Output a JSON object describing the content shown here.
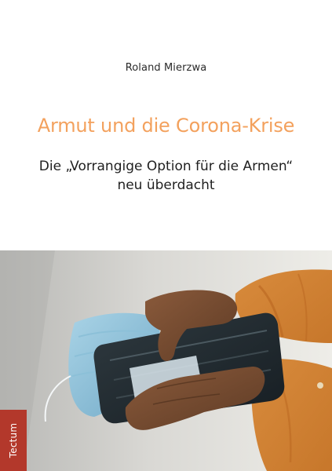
{
  "cover": {
    "author": "Roland Mierzwa",
    "title": "Armut und die Corona-Krise",
    "subtitle_line_1": "Die „Vorrangige Option für die Armen“",
    "subtitle_line_2": "neu überdacht",
    "publisher": "Tectum"
  },
  "colors": {
    "title_accent": "#f3a15d",
    "publisher_tab": "#b3382b",
    "text_dark": "#1f1f1f"
  },
  "photo": {
    "elements": [
      "hands",
      "wallet",
      "face-mask",
      "shirt-sleeves"
    ]
  }
}
